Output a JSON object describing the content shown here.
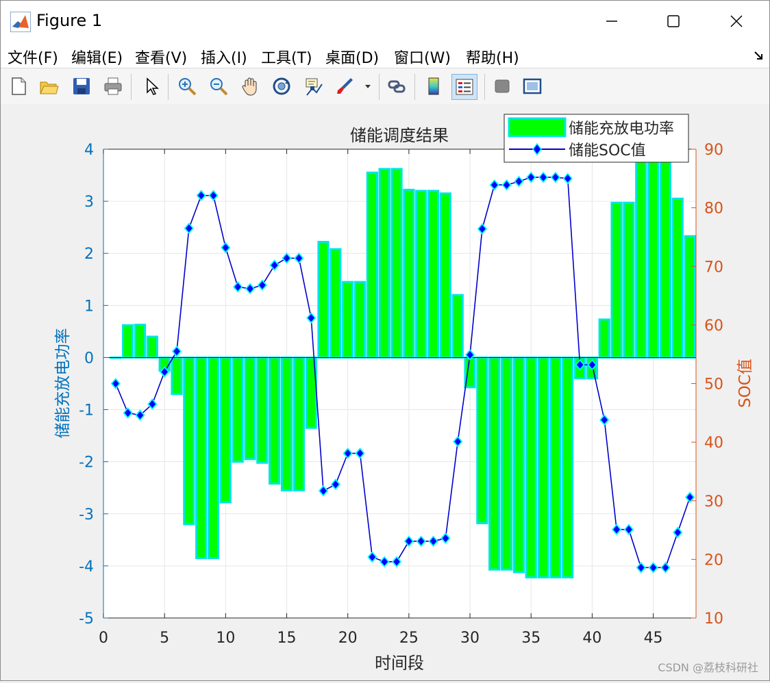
{
  "window": {
    "title": "Figure 1",
    "controls": {
      "minimize": "minimize",
      "maximize": "maximize",
      "close": "close"
    }
  },
  "menu": {
    "items": [
      "文件(F)",
      "编辑(E)",
      "查看(V)",
      "插入(I)",
      "工具(T)",
      "桌面(D)",
      "窗口(W)",
      "帮助(H)"
    ]
  },
  "toolbar": {
    "icons": [
      "new-figure-icon",
      "open-file-icon",
      "save-icon",
      "print-icon",
      "select-pointer-icon",
      "zoom-in-icon",
      "zoom-out-icon",
      "pan-hand-icon",
      "rotate-3d-icon",
      "data-cursor-icon",
      "brush-icon",
      "link-plot-icon",
      "colorbar-icon",
      "legend-icon",
      "hide-plot-tools-icon",
      "show-plot-tools-icon"
    ]
  },
  "chart_data": {
    "type": "bar",
    "title": "储能调度结果",
    "xlabel": "时间段",
    "ylabel_left": "储能充放电功率",
    "ylabel_right": "SOC值",
    "xlim": [
      0,
      48.5
    ],
    "ylim_left": [
      -5,
      4
    ],
    "ylim_right": [
      10,
      90
    ],
    "xticks": [
      0,
      5,
      10,
      15,
      20,
      25,
      30,
      35,
      40,
      45
    ],
    "yticks_left": [
      -5,
      -4,
      -3,
      -2,
      -1,
      0,
      1,
      2,
      3,
      4
    ],
    "yticks_right": [
      10,
      20,
      30,
      40,
      50,
      60,
      70,
      80,
      90
    ],
    "grid": true,
    "legend_position": "top-right",
    "x": [
      1,
      2,
      3,
      4,
      5,
      6,
      7,
      8,
      9,
      10,
      11,
      12,
      13,
      14,
      15,
      16,
      17,
      18,
      19,
      20,
      21,
      22,
      23,
      24,
      25,
      26,
      27,
      28,
      29,
      30,
      31,
      32,
      33,
      34,
      35,
      36,
      37,
      38,
      39,
      40,
      41,
      42,
      43,
      44,
      45,
      46,
      47,
      48
    ],
    "series": [
      {
        "name": "储能充放电功率",
        "kind": "bar",
        "axis": "left",
        "color": "#00ff00",
        "edge_color": "#00e5e5",
        "values": [
          0.0,
          0.62,
          0.63,
          0.4,
          -0.25,
          -0.7,
          -3.2,
          -3.85,
          -3.85,
          -2.78,
          -2.0,
          -1.95,
          -2.02,
          -2.42,
          -2.55,
          -2.55,
          -1.35,
          2.22,
          2.08,
          1.45,
          1.45,
          3.55,
          3.62,
          3.62,
          3.22,
          3.2,
          3.2,
          3.15,
          1.2,
          -0.57,
          -3.18,
          -4.07,
          -4.07,
          -4.12,
          -4.22,
          -4.22,
          -4.22,
          -4.22,
          -0.4,
          -0.4,
          0.73,
          2.97,
          2.97,
          4.0,
          4.0,
          4.0,
          3.05,
          2.33
        ]
      },
      {
        "name": "储能SOC值",
        "kind": "line",
        "axis": "right",
        "color": "#0000cc",
        "marker": "diamond",
        "marker_fill": "#0000ff",
        "marker_edge": "#00ffff",
        "values": [
          50.0,
          45.0,
          44.6,
          46.5,
          52.0,
          55.5,
          76.5,
          82.1,
          82.1,
          73.2,
          66.5,
          66.2,
          66.8,
          70.2,
          71.4,
          71.4,
          61.2,
          31.7,
          32.8,
          38.1,
          38.1,
          20.4,
          19.6,
          19.6,
          23.1,
          23.1,
          23.1,
          23.6,
          40.1,
          54.9,
          76.4,
          83.9,
          83.9,
          84.5,
          85.2,
          85.2,
          85.2,
          85.0,
          53.2,
          53.2,
          43.8,
          25.1,
          25.1,
          18.6,
          18.6,
          18.6,
          24.6,
          30.6
        ]
      }
    ],
    "colors": {
      "left_axis": "#0072bd",
      "right_axis": "#d95319"
    }
  },
  "watermark": "CSDN @荔枝科研社"
}
